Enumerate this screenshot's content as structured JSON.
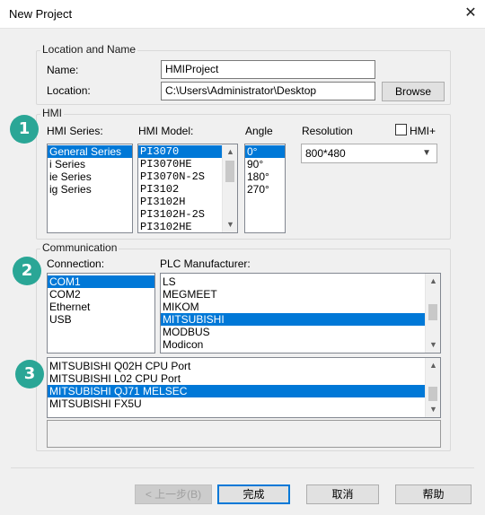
{
  "window": {
    "title": "New Project",
    "close_glyph": "✕"
  },
  "location": {
    "group_title": "Location and Name",
    "name_label": "Name:",
    "name_value": "HMIProject",
    "location_label": "Location:",
    "location_value": "C:\\Users\\Administrator\\Desktop",
    "browse_label": "Browse"
  },
  "hmi": {
    "group_title": "HMI",
    "badge": "1",
    "series_label": "HMI Series:",
    "series": [
      "General Series",
      "i Series",
      "ie Series",
      "ig Series"
    ],
    "series_selected": 0,
    "model_label": "HMI Model:",
    "models": [
      "PI3070",
      "PI3070HE",
      "PI3070N-2S",
      "PI3102",
      "PI3102H",
      "PI3102H-2S",
      "PI3102HE"
    ],
    "model_selected": 0,
    "angle_label": "Angle",
    "angles": [
      "0°",
      "90°",
      "180°",
      "270°"
    ],
    "angle_selected": 0,
    "resolution_label": "Resolution",
    "resolution_value": "800*480",
    "hmi_plus_label": "HMI+",
    "hmi_plus_checked": false
  },
  "communication": {
    "group_title": "Communication",
    "badge2": "2",
    "badge3": "3",
    "connection_label": "Connection:",
    "connections": [
      "COM1",
      "COM2",
      "Ethernet",
      "USB"
    ],
    "connection_selected": 0,
    "plc_label": "PLC Manufacturer:",
    "manufacturers": [
      "LS",
      "MEGMEET",
      "MIKOM",
      "MITSUBISHI",
      "MODBUS",
      "Modicon"
    ],
    "manufacturer_selected": 3,
    "protocols": [
      "MITSUBISHI Q02H CPU Port",
      "MITSUBISHI L02 CPU Port",
      "MITSUBISHI QJ71 MELSEC",
      "MITSUBISHI FX5U"
    ],
    "protocol_selected": 2
  },
  "buttons": {
    "back": "< 上一步(B)",
    "finish": "完成",
    "cancel": "取消",
    "help": "帮助"
  }
}
